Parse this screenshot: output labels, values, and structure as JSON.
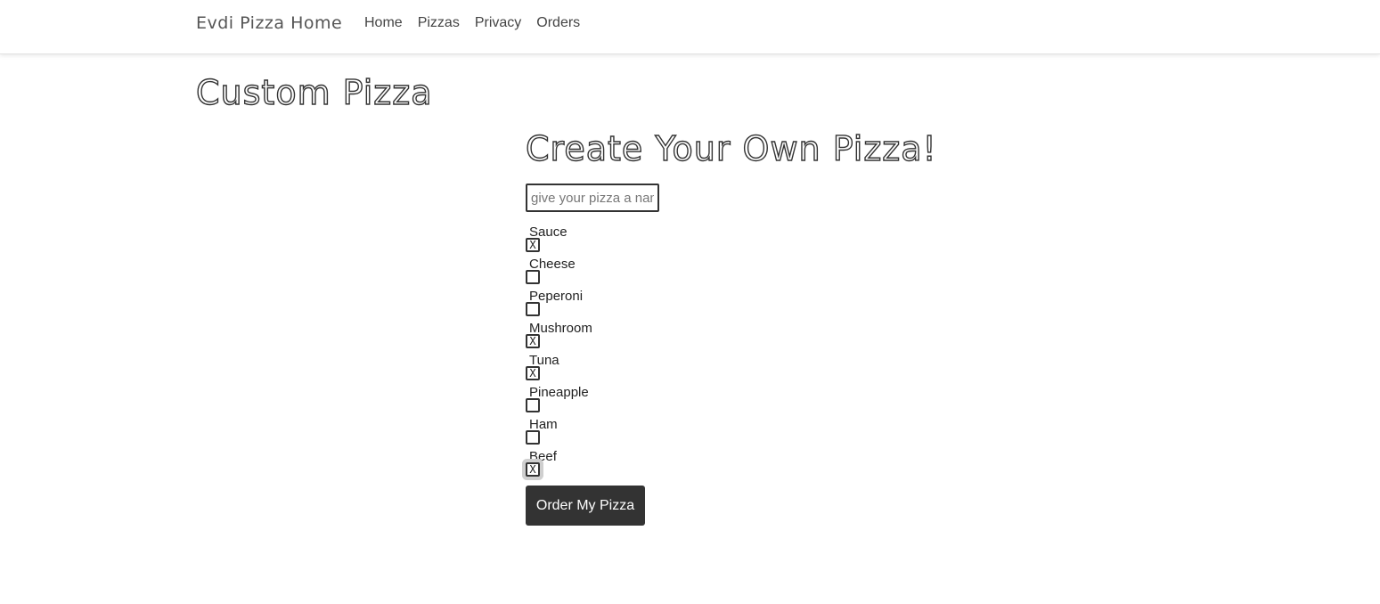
{
  "nav": {
    "brand": "Evdi Pizza Home",
    "links": [
      "Home",
      "Pizzas",
      "Privacy",
      "Orders"
    ]
  },
  "page_title": "Custom Pizza",
  "form": {
    "heading": "Create Your Own Pizza!",
    "name_placeholder": "give your pizza a name",
    "name_value": "",
    "toppings": [
      {
        "label": "Sauce",
        "checked": true
      },
      {
        "label": "Cheese",
        "checked": false
      },
      {
        "label": "Peperoni",
        "checked": false
      },
      {
        "label": "Mushroom",
        "checked": true
      },
      {
        "label": "Tuna",
        "checked": true
      },
      {
        "label": "Pineapple",
        "checked": false
      },
      {
        "label": "Ham",
        "checked": false
      },
      {
        "label": "Beef",
        "checked": true
      }
    ],
    "check_mark": "X",
    "submit_label": "Order My Pizza"
  }
}
